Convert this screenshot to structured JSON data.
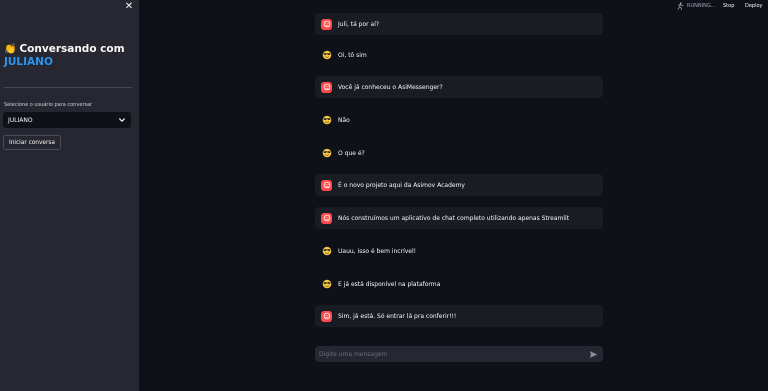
{
  "sidebar": {
    "close_glyph": "✕",
    "title_emoji": "👏",
    "title_prefix": "Conversando com",
    "title_user": "JULIANO",
    "select_label": "Selecione o usuário para conversar",
    "select_value": "JULIANO",
    "start_button": "Iniciar conversa"
  },
  "header": {
    "running": "RUNNING...",
    "stop": "Stop",
    "deploy": "Deploy"
  },
  "messages": [
    {
      "role": "user",
      "text": "Juli, tá por aí?"
    },
    {
      "role": "bot",
      "text": "Oi, tô sim"
    },
    {
      "role": "user",
      "text": "Você já conheceu o AsiMessenger?"
    },
    {
      "role": "bot",
      "text": "Não"
    },
    {
      "role": "bot",
      "text": "O que é?"
    },
    {
      "role": "user",
      "text": "É o novo projeto aqui da Asimov Academy"
    },
    {
      "role": "user",
      "text": "Nós construímos um aplicativo de chat completo utilizando apenas Streamlit"
    },
    {
      "role": "bot",
      "text": "Uauu, isso é bem incrível!"
    },
    {
      "role": "bot",
      "text": "E já está disponível na plataforma"
    },
    {
      "role": "user",
      "text": "Sim, já está. Só entrar lá pra conferir!!!"
    }
  ],
  "chat_input": {
    "placeholder": "Digite uma mensagem"
  },
  "colors": {
    "background": "#0e1117",
    "sidebar": "#262730",
    "accent": "#2b95ed",
    "user_avatar": "#ff4b4b"
  },
  "icons": {
    "user_avatar": "face-icon",
    "bot_avatar": "sunglasses-smile-icon",
    "send": "send-icon",
    "running": "running-figure-icon",
    "close": "close-icon",
    "select": "chevron-down-icon"
  }
}
